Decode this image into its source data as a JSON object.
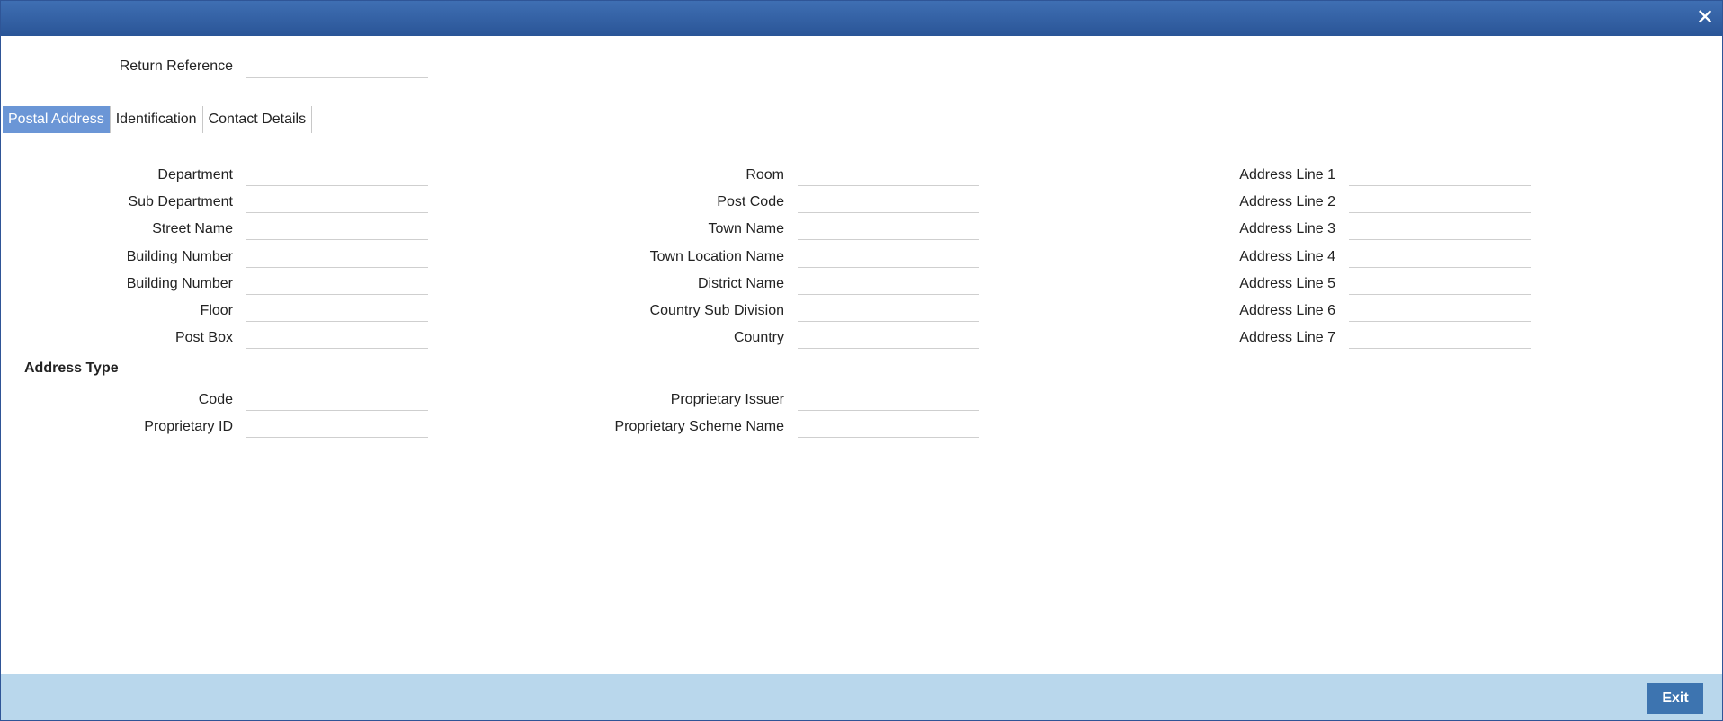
{
  "window": {
    "close_symbol": "✕"
  },
  "header": {
    "return_reference_label": "Return Reference",
    "return_reference_value": ""
  },
  "tabs": [
    {
      "label": "Postal Address",
      "active": true
    },
    {
      "label": "Identification",
      "active": false
    },
    {
      "label": "Contact Details",
      "active": false
    }
  ],
  "postal": {
    "col1": [
      {
        "label": "Department",
        "value": ""
      },
      {
        "label": "Sub Department",
        "value": ""
      },
      {
        "label": "Street Name",
        "value": ""
      },
      {
        "label": "Building Number",
        "value": ""
      },
      {
        "label": "Building Number",
        "value": ""
      },
      {
        "label": "Floor",
        "value": ""
      },
      {
        "label": "Post Box",
        "value": ""
      }
    ],
    "col2": [
      {
        "label": "Room",
        "value": ""
      },
      {
        "label": "Post Code",
        "value": ""
      },
      {
        "label": "Town Name",
        "value": ""
      },
      {
        "label": "Town Location Name",
        "value": ""
      },
      {
        "label": "District Name",
        "value": ""
      },
      {
        "label": "Country Sub Division",
        "value": ""
      },
      {
        "label": "Country",
        "value": ""
      }
    ],
    "col3": [
      {
        "label": "Address Line 1",
        "value": ""
      },
      {
        "label": "Address Line 2",
        "value": ""
      },
      {
        "label": "Address Line 3",
        "value": ""
      },
      {
        "label": "Address Line 4",
        "value": ""
      },
      {
        "label": "Address Line 5",
        "value": ""
      },
      {
        "label": "Address Line 6",
        "value": ""
      },
      {
        "label": "Address Line 7",
        "value": ""
      }
    ]
  },
  "address_type": {
    "title": "Address Type",
    "col1": [
      {
        "label": "Code",
        "value": ""
      },
      {
        "label": "Proprietary ID",
        "value": ""
      }
    ],
    "col2": [
      {
        "label": "Proprietary Issuer",
        "value": ""
      },
      {
        "label": "Proprietary Scheme Name",
        "value": ""
      }
    ]
  },
  "footer": {
    "exit_label": "Exit"
  },
  "colors": {
    "titlebar": "#2a5597",
    "active_tab": "#6b96d6",
    "footer": "#b9d7ec",
    "exit_button": "#3d74b0"
  }
}
